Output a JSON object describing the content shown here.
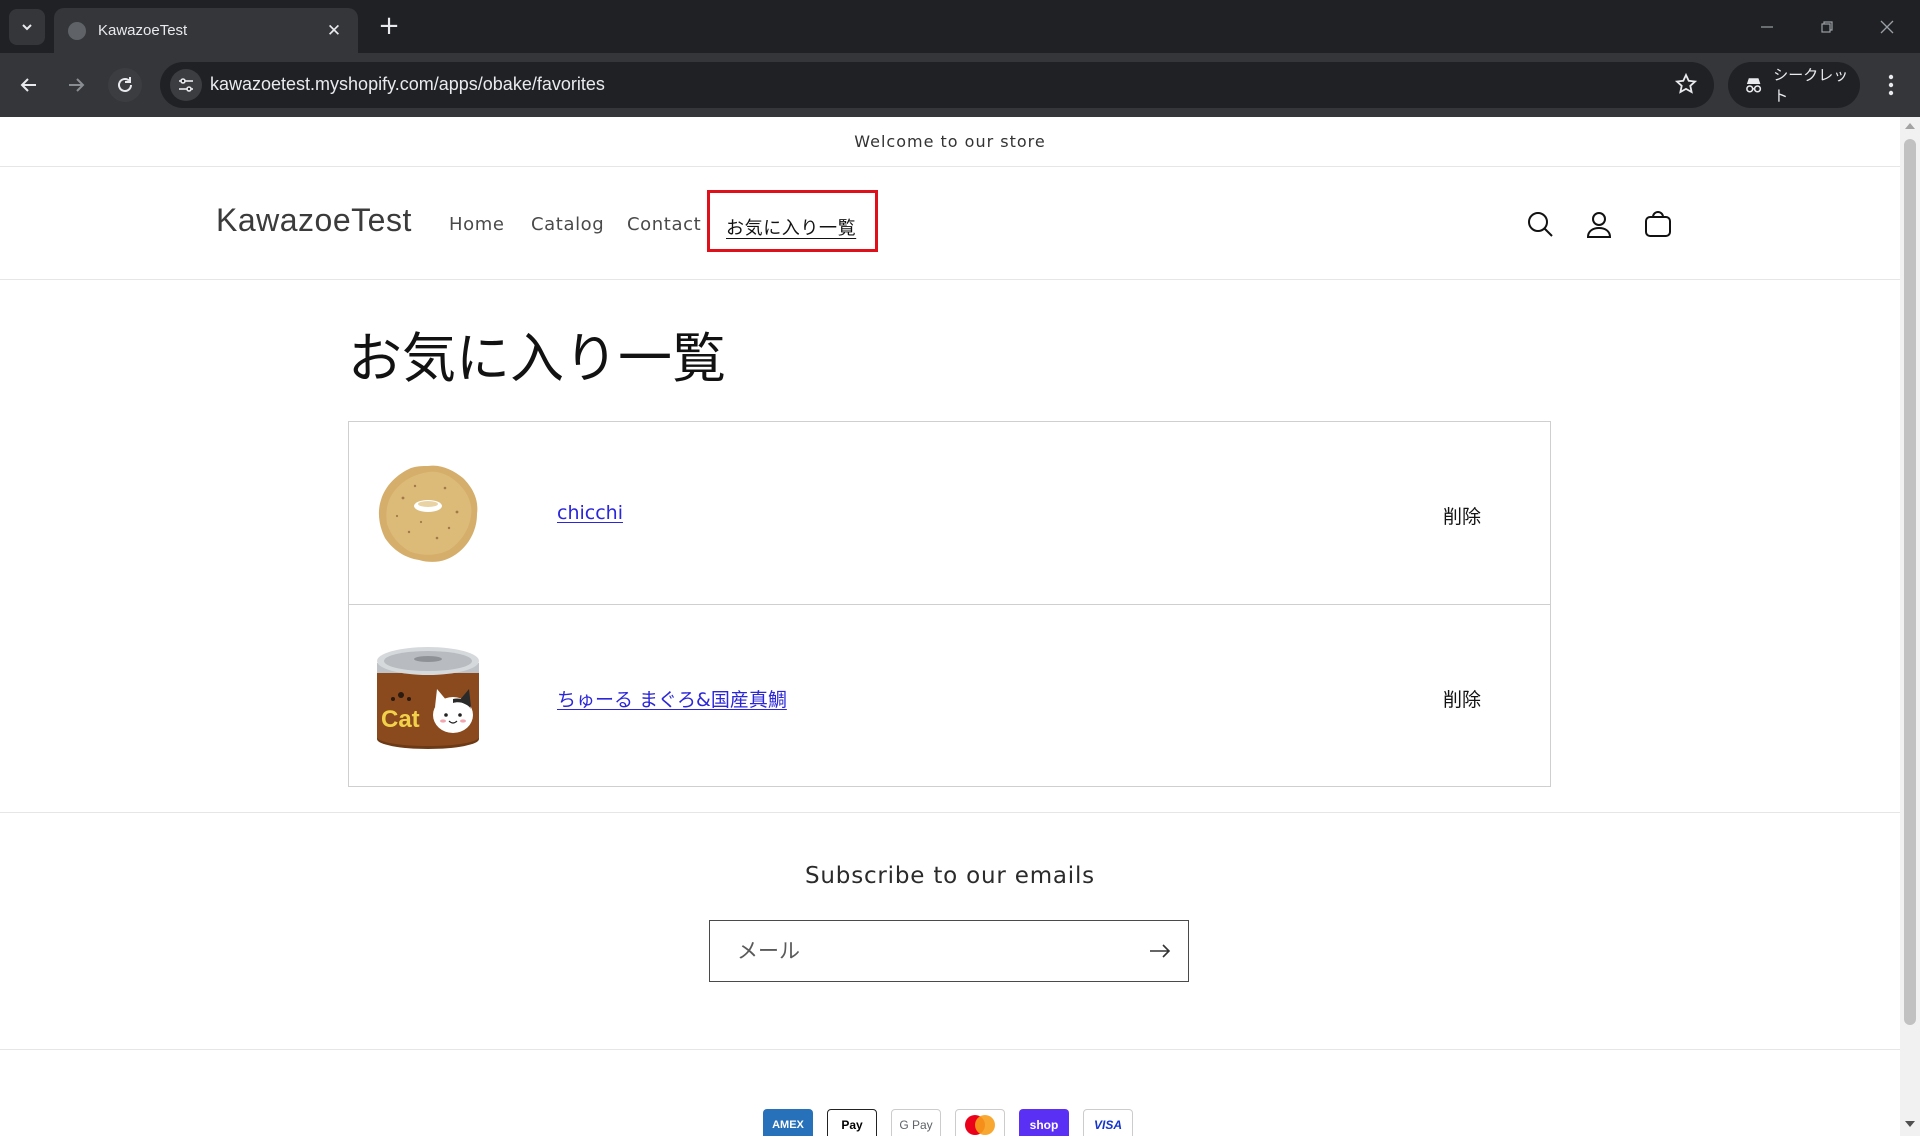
{
  "browser": {
    "tab_title": "KawazoeTest",
    "url": "kawazoetest.myshopify.com/apps/obake/favorites",
    "incognito_label": "シークレット"
  },
  "store": {
    "announcement": "Welcome to our store",
    "logo": "KawazoeTest",
    "menu": [
      "Home",
      "Catalog",
      "Contact",
      "お気に入り一覧"
    ]
  },
  "page": {
    "title": "お気に入り一覧",
    "favorites": [
      {
        "name": "chicchi",
        "image_icon": "donut-cookie-icon",
        "delete_label": "削除"
      },
      {
        "name": "ちゅーる まぐろ&国産真鯛",
        "image_icon": "cat-food-can-icon",
        "delete_label": "削除"
      }
    ]
  },
  "footer": {
    "subscribe_title": "Subscribe to our emails",
    "email_placeholder": "メール",
    "payment_methods": [
      "AMEX",
      "Pay",
      "G Pay",
      "",
      "shop",
      "VISA"
    ]
  },
  "colors": {
    "highlight": "#e0101b",
    "link": "#2b26d9"
  }
}
